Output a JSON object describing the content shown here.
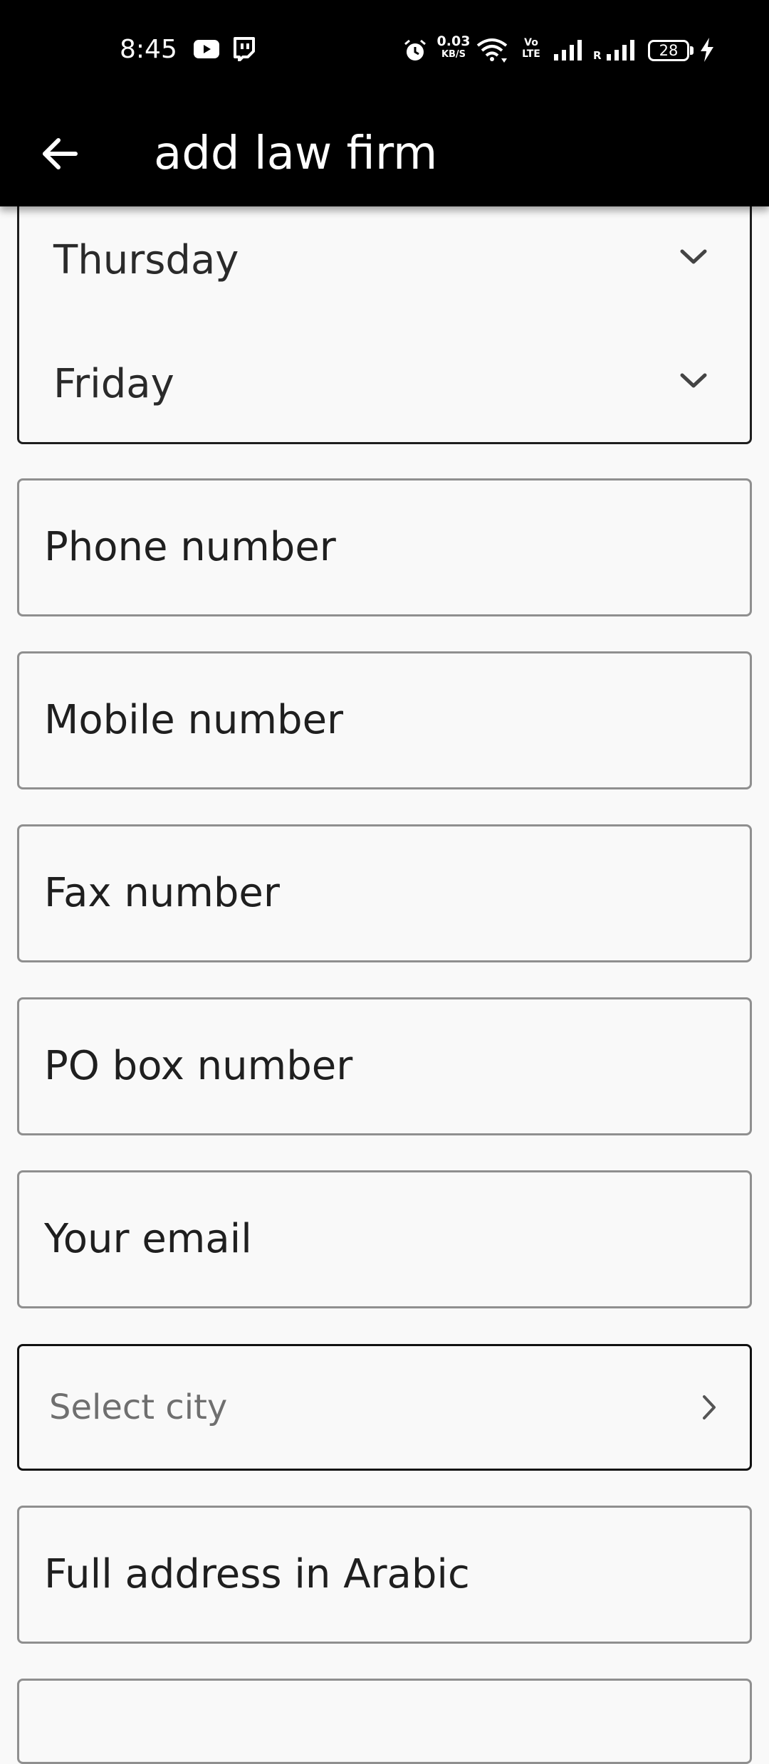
{
  "status_bar": {
    "time": "8:45",
    "speed_value": "0.03",
    "speed_unit": "KB/S",
    "volte_top": "Vo",
    "volte_bottom": "LTE",
    "roaming": "R",
    "battery": "28",
    "icons": [
      "youtube-icon",
      "twitch-icon",
      "alarm-icon",
      "wifi-icon",
      "signal-icon",
      "signal-icon",
      "battery-icon",
      "charging-icon"
    ]
  },
  "app_bar": {
    "title": "add law firm",
    "back_icon": "arrow-left-icon"
  },
  "working_days": {
    "items": [
      {
        "label": "Thursday"
      },
      {
        "label": "Friday"
      }
    ]
  },
  "form": {
    "phone_label": "Phone number",
    "mobile_label": "Mobile number",
    "fax_label": "Fax number",
    "po_box_label": "PO box number",
    "email_label": "Your email",
    "city_placeholder": "Select city",
    "address_arabic_label": "Full address in Arabic"
  }
}
